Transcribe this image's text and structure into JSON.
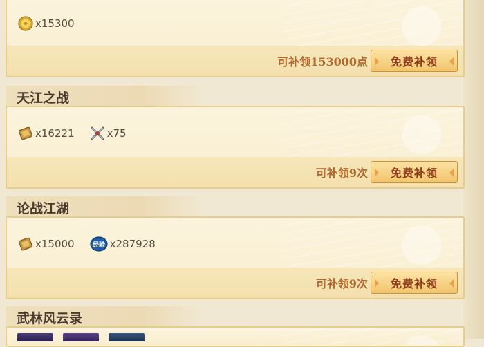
{
  "sections": [
    {
      "title": "",
      "rewards": [
        {
          "icon": "gold-coin-icon",
          "amount": "x15300"
        }
      ],
      "claim_text": "可补领153000点",
      "button_label": "免费补领"
    },
    {
      "title": "天江之战",
      "rewards": [
        {
          "icon": "silver-ticket-icon",
          "amount": "x16221"
        },
        {
          "icon": "crossed-swords-icon",
          "amount": "x75"
        }
      ],
      "claim_text": "可补领9次",
      "button_label": "免费补领"
    },
    {
      "title": "论战江湖",
      "rewards": [
        {
          "icon": "silver-ticket-icon",
          "amount": "x15000"
        },
        {
          "icon": "experience-badge-icon",
          "icon_text": "经验",
          "amount": "x287928"
        }
      ],
      "claim_text": "可补领9次",
      "button_label": "免费补领"
    },
    {
      "title": "武林风云录"
    }
  ],
  "colors": {
    "claim_text": "#b0682d",
    "button_text": "#8d3a1a",
    "button_bg": "#f2c56e",
    "card_border": "#e6cd8d"
  }
}
